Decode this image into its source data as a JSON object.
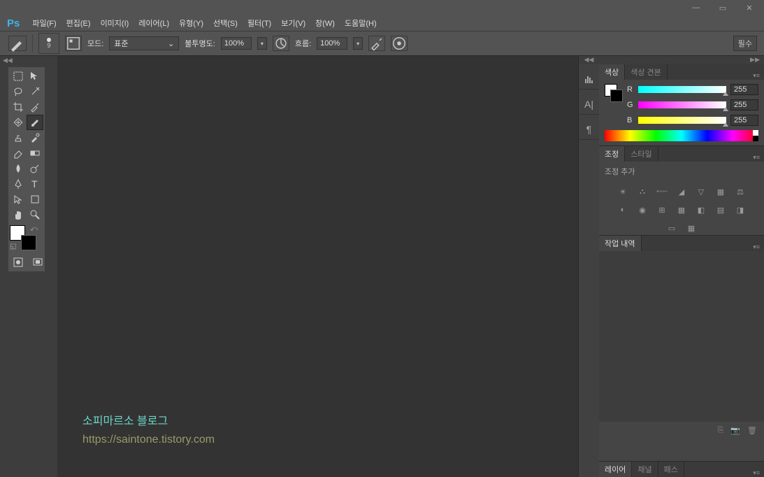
{
  "menubar": {
    "file": "파일(F)",
    "edit": "편집(E)",
    "image": "이미지(I)",
    "layer": "레이어(L)",
    "type": "유형(Y)",
    "select": "선택(S)",
    "filter": "필터(T)",
    "view": "보기(V)",
    "window": "창(W)",
    "help": "도움말(H)"
  },
  "optionbar": {
    "brush_size": "9",
    "mode_label": "모드:",
    "mode_value": "표준",
    "opacity_label": "불투명도:",
    "opacity_value": "100%",
    "flow_label": "흐름:",
    "flow_value": "100%",
    "required": "필수"
  },
  "color_panel": {
    "tab_color": "색상",
    "tab_swatches": "색상 견본",
    "r_label": "R",
    "g_label": "G",
    "b_label": "B",
    "r_value": "255",
    "g_value": "255",
    "b_value": "255"
  },
  "adjust_panel": {
    "tab_adjust": "조정",
    "tab_style": "스타일",
    "add_label": "조정 추가"
  },
  "history_panel": {
    "tab_history": "작업 내역"
  },
  "layers_panel": {
    "tab_layers": "레이어",
    "tab_channels": "채널",
    "tab_paths": "패스"
  },
  "watermark": {
    "title": "소피마르소 블로그",
    "url": "https://saintone.tistory.com"
  }
}
